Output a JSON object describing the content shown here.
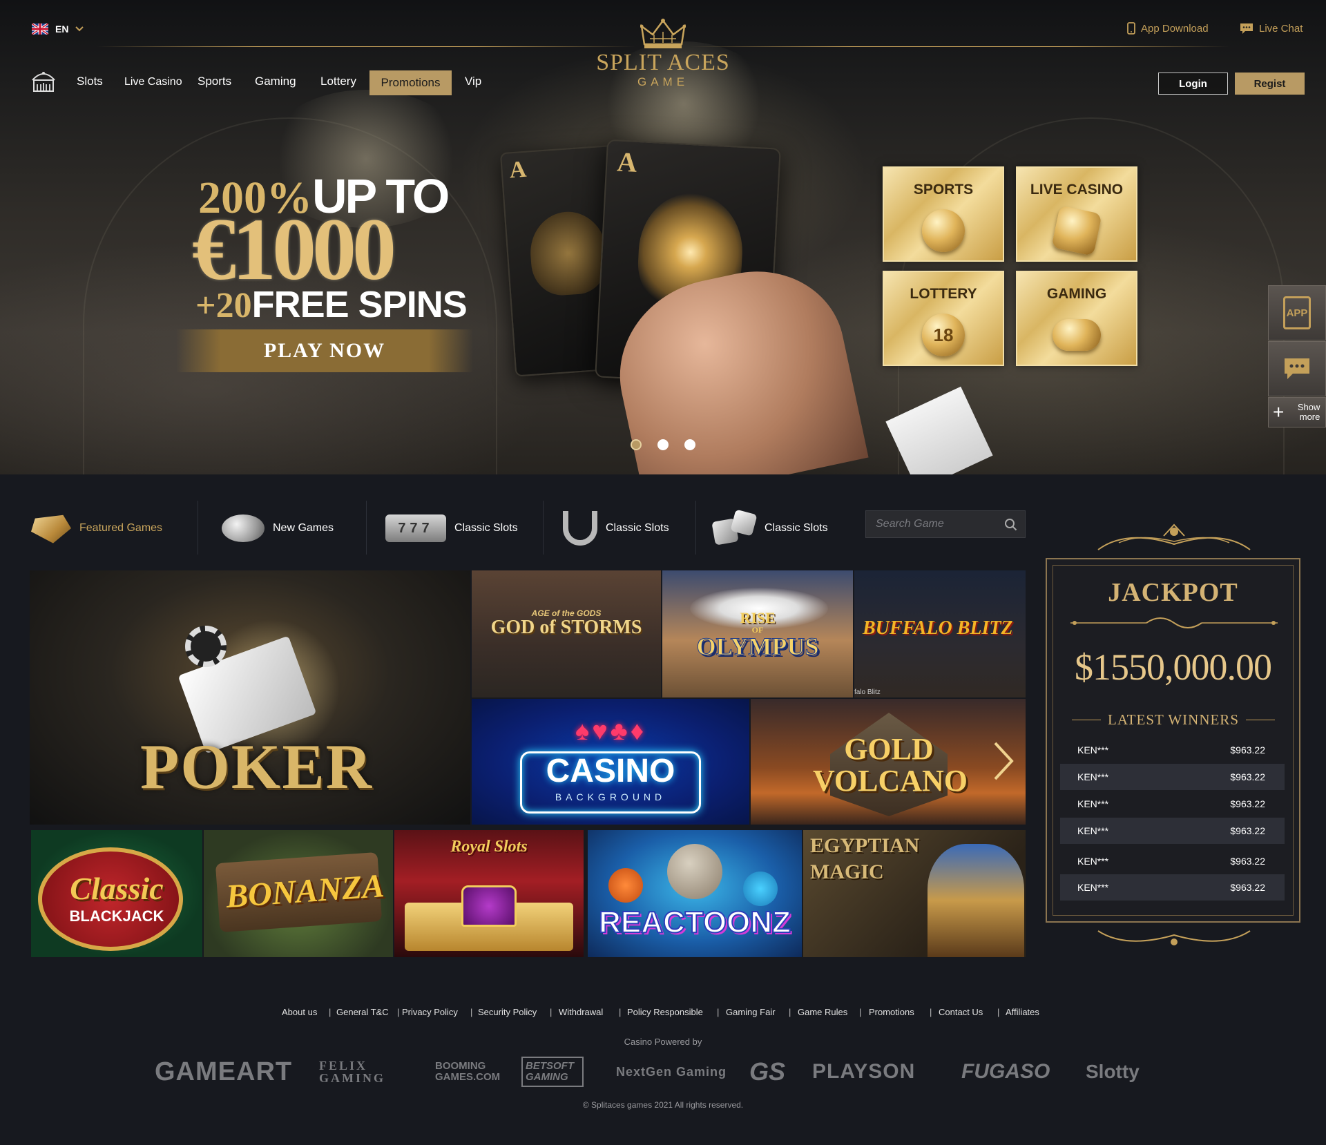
{
  "header": {
    "language": "EN",
    "app_download": "App Download",
    "live_chat": "Live Chat",
    "logo_line1": "SPLIT ACES",
    "logo_line2": "GAME",
    "nav": [
      "Slots",
      "Live Casino",
      "Sports",
      "Gaming",
      "Lottery",
      "Promotions",
      "Vip"
    ],
    "active_nav": "Promotions",
    "login": "Login",
    "register": "Regist"
  },
  "hero": {
    "line1_gold": "200%",
    "line1_white": "UP TO",
    "amount": "€1000",
    "spins_gold": "+20",
    "spins_white": "FREE SPINS",
    "cta": "PLAY NOW",
    "card_letter": "A",
    "slides": 3,
    "active_slide": 0,
    "tiles": [
      "SPORTS",
      "LIVE CASINO",
      "LOTTERY",
      "GAMING"
    ],
    "lottery_number": "18"
  },
  "side": {
    "app_label": "APP",
    "show_more": "Show more"
  },
  "game_tabs": {
    "items": [
      "Featured Games",
      "New Games",
      "Classic Slots",
      "Classic Slots",
      "Classic Slots"
    ],
    "active": 0,
    "search_placeholder": "Search Game",
    "slot_digits": "777"
  },
  "games": {
    "poker": "POKER",
    "god_storms_small": "AGE of the GODS",
    "god_storms": "GOD of STORMS",
    "olympus_top": "RISE",
    "olympus_mid": "OF",
    "olympus": "OLYMPUS",
    "buffalo": "BUFFALO BLITZ",
    "buffalo_small": "falo Blitz",
    "casino": "CASINO",
    "casino_sub": "BACKGROUND",
    "gold_volcano": "GOLD VOLCANO",
    "classic": "Classic",
    "blackjack": "BLACKJACK",
    "bonanza": "BONANZA",
    "royal_slots": "Royal Slots",
    "reactoonz": "REACTOONZ",
    "egyptian": "EGYPTIAN",
    "magic": "MAGIC"
  },
  "jackpot": {
    "title": "JACKPOT",
    "amount": "$1550,000.00",
    "latest": "LATEST WINNERS",
    "winners": [
      {
        "name": "KEN***",
        "amount": "$963.22"
      },
      {
        "name": "KEN***",
        "amount": "$963.22"
      },
      {
        "name": "KEN***",
        "amount": "$963.22"
      },
      {
        "name": "KEN***",
        "amount": "$963.22"
      },
      {
        "name": "KEN***",
        "amount": "$963.22"
      },
      {
        "name": "KEN***",
        "amount": "$963.22"
      }
    ]
  },
  "footer": {
    "links": [
      "About us",
      "General T&C",
      "Privacy Policy",
      "Security Policy",
      "Withdrawal",
      "Policy Responsible",
      "Gaming Fair",
      "Game Rules",
      "Promotions",
      "Contact Us",
      "Affiliates"
    ],
    "powered": "Casino Powered by",
    "providers": [
      "GAMEART",
      "FELIX GAMING",
      "BOOMING GAMES.COM",
      "BETSOFT GAMING",
      "NextGen Gaming",
      "GS",
      "PLAYSON",
      "FUGASO",
      "Slotty"
    ],
    "copyright": "© Splitaces games 2021  All rights reserved."
  },
  "colors": {
    "accent_gold": "#b89a64",
    "page_bg": "#17191f",
    "jackpot_border": "#8c7550"
  }
}
